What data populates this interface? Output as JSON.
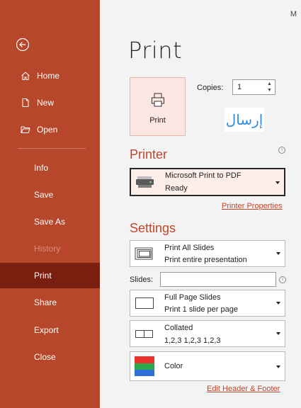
{
  "sidebar": {
    "back_label": "Back",
    "items": [
      {
        "label": "Home"
      },
      {
        "label": "New"
      },
      {
        "label": "Open"
      },
      {
        "label": "Info"
      },
      {
        "label": "Save"
      },
      {
        "label": "Save As"
      },
      {
        "label": "History"
      },
      {
        "label": "Print"
      },
      {
        "label": "Share"
      },
      {
        "label": "Export"
      },
      {
        "label": "Close"
      }
    ]
  },
  "header": {
    "user_initial": "M"
  },
  "main": {
    "title": "Print",
    "print_button_label": "Print",
    "copies_label": "Copies:",
    "copies_value": "1",
    "arabic_text": "إرسال",
    "printer_section": "Printer",
    "printer": {
      "name": "Microsoft Print to PDF",
      "status": "Ready"
    },
    "printer_properties_link": "Printer Properties",
    "settings_section": "Settings",
    "settings": [
      {
        "line1": "Print All Slides",
        "line2": "Print entire presentation"
      },
      {
        "line1": "Full Page Slides",
        "line2": "Print 1 slide per page"
      },
      {
        "line1": "Collated",
        "line2": "1,2,3   1,2,3   1,2,3"
      },
      {
        "line1": "Color"
      }
    ],
    "slides_label": "Slides:",
    "slides_value": "",
    "edit_header_footer_link": "Edit Header & Footer"
  },
  "colors": {
    "accent": "#b7472a",
    "accent_dark": "#7a1f10",
    "link": "#c0462b",
    "color_swatch": [
      "#e8332a",
      "#2aa84a",
      "#2f6fd8"
    ]
  },
  "icons": [
    "back-arrow-icon",
    "home-icon",
    "new-file-icon",
    "open-folder-icon",
    "printer-icon",
    "info-icon",
    "chevron-down-icon",
    "spin-up-icon",
    "spin-down-icon"
  ]
}
